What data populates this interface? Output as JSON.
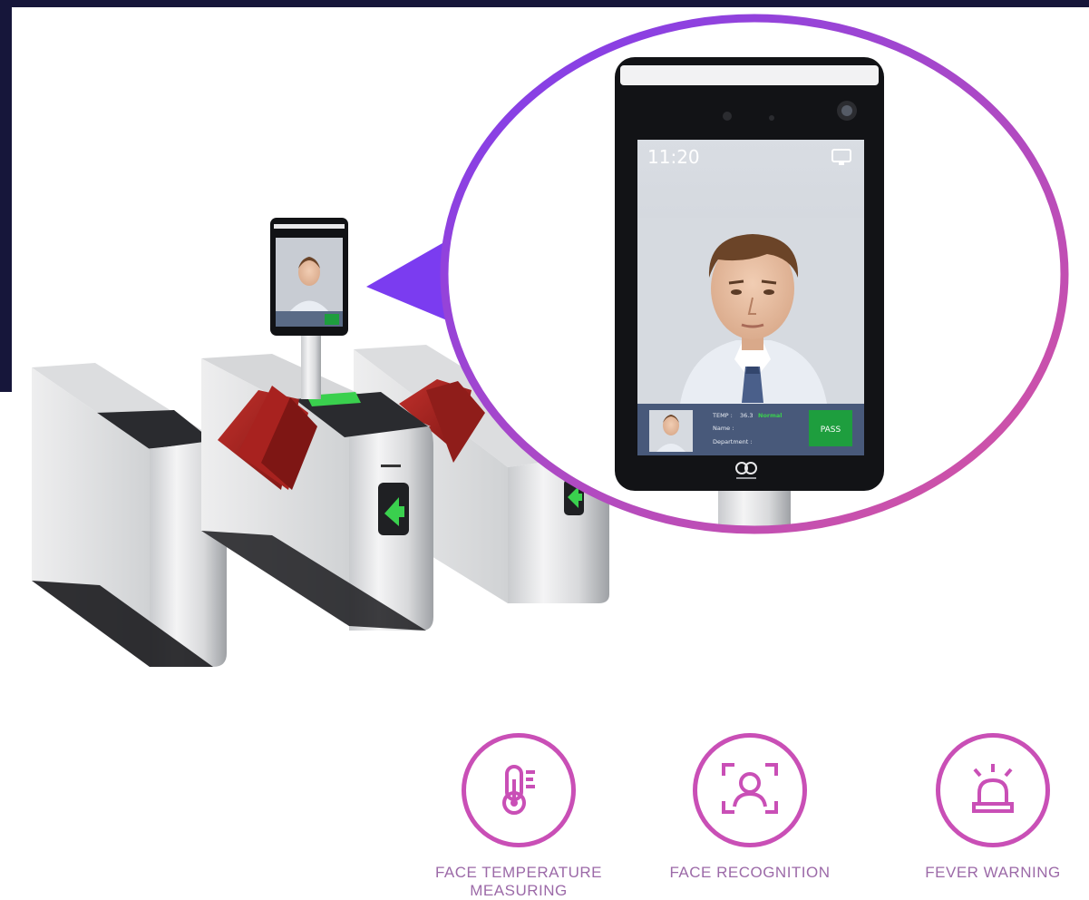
{
  "device_screen": {
    "time": "11:20",
    "temp_label": "TEMP :",
    "temp_value": "36.3",
    "temp_status": "Normal",
    "name_label": "Name :",
    "department_label": "Department :",
    "pass_button": "PASS"
  },
  "features": [
    {
      "icon": "thermometer-icon",
      "label": "FACE TEMPERATURE\nMEASURING"
    },
    {
      "icon": "face-scan-icon",
      "label": "FACE RECOGNITION"
    },
    {
      "icon": "alarm-light-icon",
      "label": "FEVER WARNING"
    }
  ],
  "colors": {
    "accent_purple": "#7b3cf0",
    "accent_pink": "#d9559e",
    "icon_magenta": "#c94fb6",
    "label_text": "#9c6aa8",
    "flap_red": "#a8221f",
    "arrow_green": "#3ad04e",
    "pass_green": "#1e9e3e",
    "frame_navy": "#16163a"
  }
}
